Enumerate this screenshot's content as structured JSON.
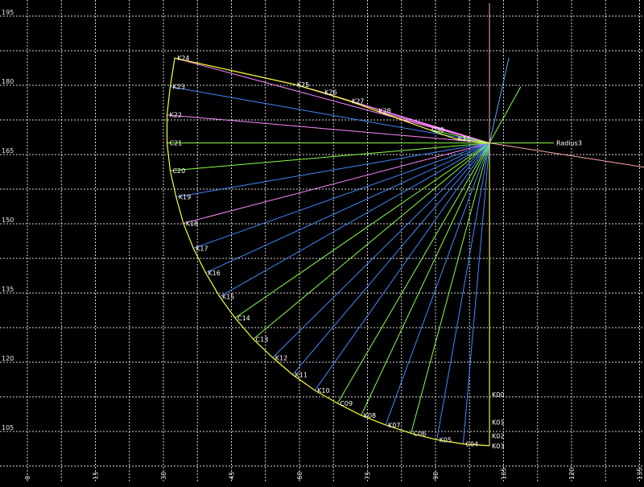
{
  "colors": {
    "background": "#000000",
    "grid": "#d8d8d8",
    "boundary": "#ffff33",
    "pink": "#ff88ff",
    "green": "#88ff44",
    "blue": "#4488ff",
    "axis_line": "#ffaaaa",
    "ray_lightblue": "#44aaff",
    "ray_lightgreen": "#88ff44"
  },
  "axes": {
    "x_ticks": [
      "0",
      "15",
      "30",
      "45",
      "60",
      "75",
      "90",
      "105",
      "120",
      "135"
    ],
    "y_ticks": [
      "195",
      "180",
      "165",
      "150",
      "135",
      "120",
      "105"
    ]
  },
  "center": {
    "x": 101.9,
    "y": 167.5
  },
  "rays": [
    {
      "label": "Radius3",
      "x": 116.1,
      "y": 167.5,
      "color": "green"
    },
    {
      "label": "",
      "x": 108.8,
      "y": 179.7,
      "color": "ray_lightgreen"
    },
    {
      "label": "",
      "x": 106.2,
      "y": 186.0,
      "color": "ray_lightblue"
    }
  ],
  "axis_line": {
    "x1": 101.9,
    "y1": 197.8,
    "x2": 101.9,
    "y2": 101.9,
    "extend_x": 137.0,
    "extend_y": 162.1
  },
  "points": [
    {
      "label": "K00",
      "x": 101.9,
      "y": 113.0,
      "color": "blue"
    },
    {
      "label": "K01",
      "x": 101.9,
      "y": 107.0,
      "color": "blue"
    },
    {
      "label": "K02",
      "x": 101.9,
      "y": 104.0,
      "color": "blue"
    },
    {
      "label": "K03",
      "x": 101.9,
      "y": 101.9,
      "color": "blue"
    },
    {
      "label": "C04",
      "x": 96.1,
      "y": 102.3,
      "color": "blue"
    },
    {
      "label": "K05",
      "x": 90.3,
      "y": 103.2,
      "color": "blue"
    },
    {
      "label": "C06",
      "x": 84.6,
      "y": 104.6,
      "color": "green"
    },
    {
      "label": "K07",
      "x": 79.0,
      "y": 106.4,
      "color": "blue"
    },
    {
      "label": "K08",
      "x": 73.6,
      "y": 108.5,
      "color": "green"
    },
    {
      "label": "C09",
      "x": 68.4,
      "y": 111.1,
      "color": "green"
    },
    {
      "label": "K10",
      "x": 63.4,
      "y": 113.9,
      "color": "blue"
    },
    {
      "label": "K11",
      "x": 58.5,
      "y": 117.3,
      "color": "blue"
    },
    {
      "label": "K12",
      "x": 54.1,
      "y": 121.0,
      "color": "blue"
    },
    {
      "label": "C13",
      "x": 49.8,
      "y": 125.0,
      "color": "green"
    },
    {
      "label": "C14",
      "x": 45.8,
      "y": 129.6,
      "color": "green"
    },
    {
      "label": "K15",
      "x": 42.4,
      "y": 134.2,
      "color": "blue"
    },
    {
      "label": "K16",
      "x": 39.3,
      "y": 139.4,
      "color": "blue"
    },
    {
      "label": "K17",
      "x": 36.6,
      "y": 144.7,
      "color": "blue"
    },
    {
      "label": "K18",
      "x": 34.4,
      "y": 150.1,
      "color": "pink"
    },
    {
      "label": "K19",
      "x": 32.8,
      "y": 155.8,
      "color": "blue"
    },
    {
      "label": "C20",
      "x": 31.5,
      "y": 161.5,
      "color": "green"
    },
    {
      "label": "C21",
      "x": 30.8,
      "y": 167.5,
      "color": "green"
    },
    {
      "label": "K22",
      "x": 30.8,
      "y": 173.6,
      "color": "pink"
    },
    {
      "label": "K23",
      "x": 31.5,
      "y": 179.7,
      "color": "blue"
    },
    {
      "label": "K24",
      "x": 32.5,
      "y": 185.9,
      "color": "pink"
    },
    {
      "label": "K25",
      "x": 58.9,
      "y": 180.2,
      "color": "pink"
    },
    {
      "label": "K26",
      "x": 65.0,
      "y": 178.5,
      "color": "pink"
    },
    {
      "label": "K27",
      "x": 71.0,
      "y": 176.6,
      "color": "pink"
    },
    {
      "label": "K28",
      "x": 76.9,
      "y": 174.5,
      "color": "pink"
    },
    {
      "label": "C30",
      "x": 88.6,
      "y": 170.4,
      "color": "green"
    },
    {
      "label": "K31",
      "x": 94.4,
      "y": 168.4,
      "color": "pink"
    }
  ]
}
